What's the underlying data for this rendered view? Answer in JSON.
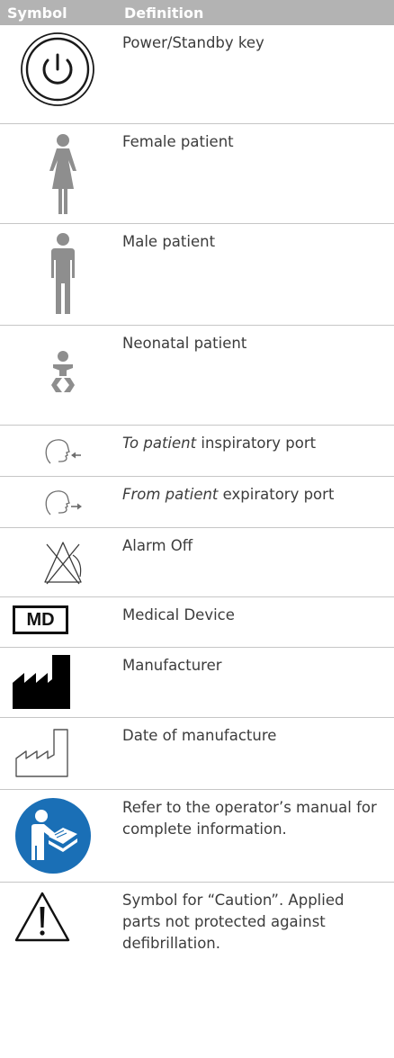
{
  "header": {
    "symbol": "Symbol",
    "definition": "Definition"
  },
  "rows": [
    {
      "icon": "power-standby-icon",
      "definition": "Power/Standby key"
    },
    {
      "icon": "female-patient-icon",
      "definition": "Female patient"
    },
    {
      "icon": "male-patient-icon",
      "definition": "Male patient"
    },
    {
      "icon": "neonatal-patient-icon",
      "definition": "Neonatal patient"
    },
    {
      "icon": "inspiratory-port-icon",
      "definition_italic": "To patient",
      "definition": " inspiratory port"
    },
    {
      "icon": "expiratory-port-icon",
      "definition_italic": "From patient",
      "definition": " expiratory port"
    },
    {
      "icon": "alarm-off-icon",
      "definition": "Alarm Off"
    },
    {
      "icon": "medical-device-icon",
      "icon_text": "MD",
      "definition": "Medical Device"
    },
    {
      "icon": "manufacturer-icon",
      "definition": "Manufacturer"
    },
    {
      "icon": "date-of-manufacture-icon",
      "definition": "Date of manufacture"
    },
    {
      "icon": "refer-to-manual-icon",
      "definition": "Refer to the operator’s manual for complete information.",
      "icon_color": "#1a6fb6"
    },
    {
      "icon": "caution-icon",
      "definition": "Symbol for “Caution”. Applied parts not protected against defibrillation."
    }
  ],
  "colors": {
    "header_bg": "#b3b3b3",
    "icon_gray": "#8e8e8e",
    "manual_blue": "#1a6fb6"
  }
}
